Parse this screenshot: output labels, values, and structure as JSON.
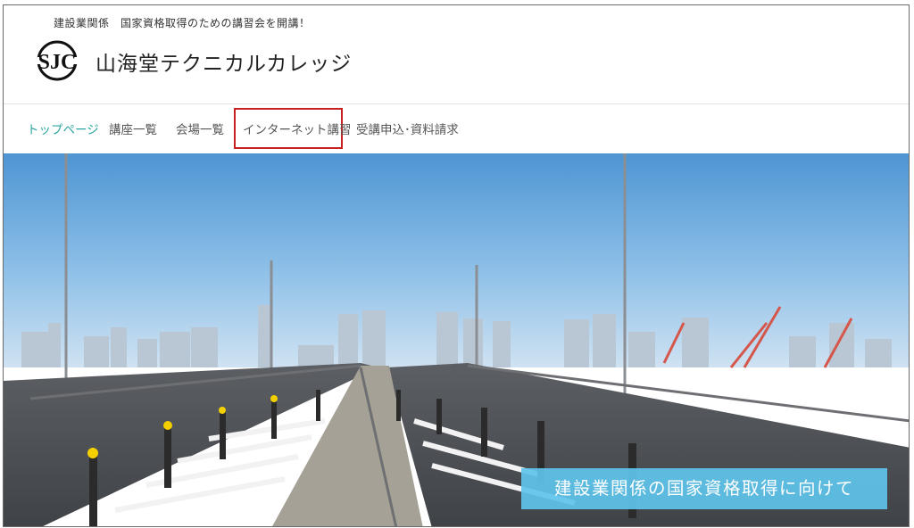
{
  "header": {
    "tagline": "建設業関係　国家資格取得のための講習会を開講！",
    "logo_text": "SJC",
    "site_title": "山海堂テクニカルカレッジ"
  },
  "nav": {
    "items": [
      {
        "label": "トップページ",
        "active": true
      },
      {
        "label": "講座一覧",
        "active": false
      },
      {
        "label": "会場一覧",
        "active": false
      },
      {
        "label": "インターネット講習",
        "active": false,
        "highlighted": true
      },
      {
        "label": "受講申込･資料請求",
        "active": false
      }
    ]
  },
  "hero": {
    "caption": "建設業関係の国家資格取得に向けて"
  },
  "colors": {
    "nav_active": "#2aa5a0",
    "highlight_box": "#c8201e",
    "caption_bg": "#5ec4eb"
  }
}
